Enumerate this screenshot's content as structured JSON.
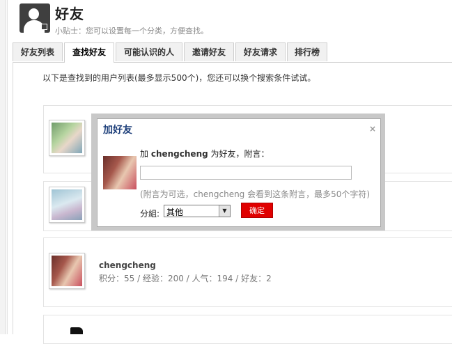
{
  "header": {
    "title": "好友",
    "tip": "小贴士：您可以设置每一个分类，方便查找。"
  },
  "tabs": [
    {
      "label": "好友列表",
      "active": false
    },
    {
      "label": "查找好友",
      "active": true
    },
    {
      "label": "可能认识的人",
      "active": false
    },
    {
      "label": "邀请好友",
      "active": false
    },
    {
      "label": "好友请求",
      "active": false
    },
    {
      "label": "排行榜",
      "active": false
    }
  ],
  "description": "以下是查找到的用户列表(最多显示500个)，您还可以换个搜索条件试试。",
  "results": [
    {
      "name": "chengcheng",
      "stats": "积分：55 / 经验：200 / 人气：194 / 好友：2"
    }
  ],
  "dialog": {
    "title": "加好友",
    "close": "×",
    "prompt_prefix": "加",
    "username": "chengcheng",
    "prompt_suffix": "为好友，附言：",
    "message_value": "",
    "hint": "(附言为可选，chengcheng 会看到这条附言，最多50个字符)",
    "group_label": "分組:",
    "group_selected": "其他",
    "confirm_label": "确定"
  },
  "icons": {
    "header_avatar": "user-silhouette-icon",
    "dropdown_arrow": "triangle-down-icon"
  }
}
